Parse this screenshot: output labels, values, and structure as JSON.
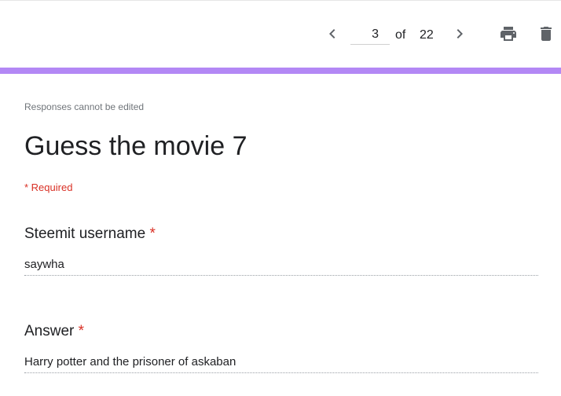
{
  "toolbar": {
    "current_page": "3",
    "of_label": "of",
    "total_pages": "22",
    "icons": {
      "prev": "chevron-left-icon",
      "next": "chevron-right-icon",
      "print": "print-icon",
      "delete": "trash-icon"
    }
  },
  "colors": {
    "accent": "#b388f5",
    "required": "#d93025",
    "text": "#202124",
    "icon": "#5f6368"
  },
  "form": {
    "notice": "Responses cannot be edited",
    "title": "Guess the movie 7",
    "required_note": "* Required",
    "questions": [
      {
        "title": "Steemit username",
        "required_mark": "*",
        "answer": "saywha"
      },
      {
        "title": "Answer",
        "required_mark": "*",
        "answer": "Harry potter and the prisoner of askaban"
      }
    ]
  }
}
